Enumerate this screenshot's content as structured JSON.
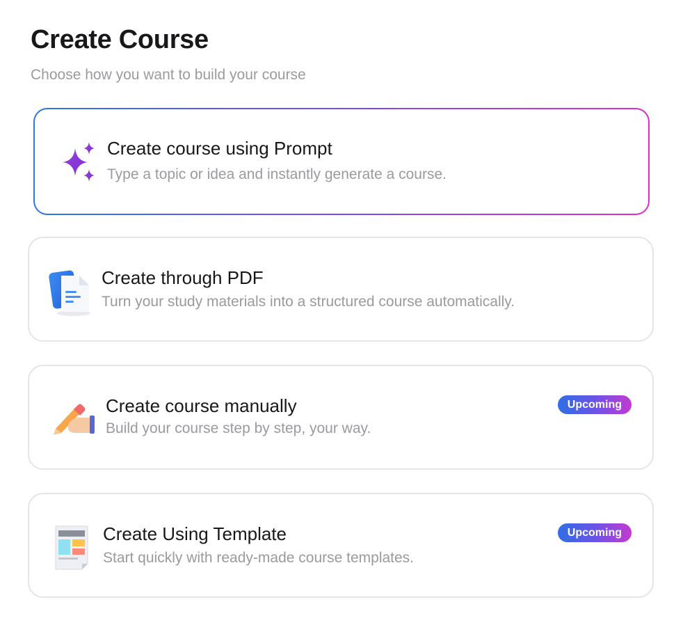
{
  "header": {
    "title": "Create Course",
    "subtitle": "Choose how you want to build your course"
  },
  "options": [
    {
      "title": "Create course using Prompt",
      "description": "Type a topic or idea and instantly generate a course.",
      "icon": "sparkles-icon",
      "selected": true
    },
    {
      "title": "Create through PDF",
      "description": "Turn your study materials into a structured course automatically.",
      "icon": "pdf-document-icon"
    },
    {
      "title": "Create course manually",
      "description": "Build your course step by step, your way.",
      "icon": "hand-pencil-icon",
      "badge": "Upcoming"
    },
    {
      "title": "Create Using Template",
      "description": "Start quickly with ready-made course templates.",
      "icon": "template-icon",
      "badge": "Upcoming"
    }
  ],
  "colors": {
    "selected_border_start": "#2f76e0",
    "selected_border_end": "#d92fc7",
    "sparkle": "#8b3bd9",
    "badge_start": "#2f6fe4",
    "badge_end": "#c43ad0",
    "card_border": "#e5e5e7",
    "muted_text": "#9a9a9f"
  }
}
